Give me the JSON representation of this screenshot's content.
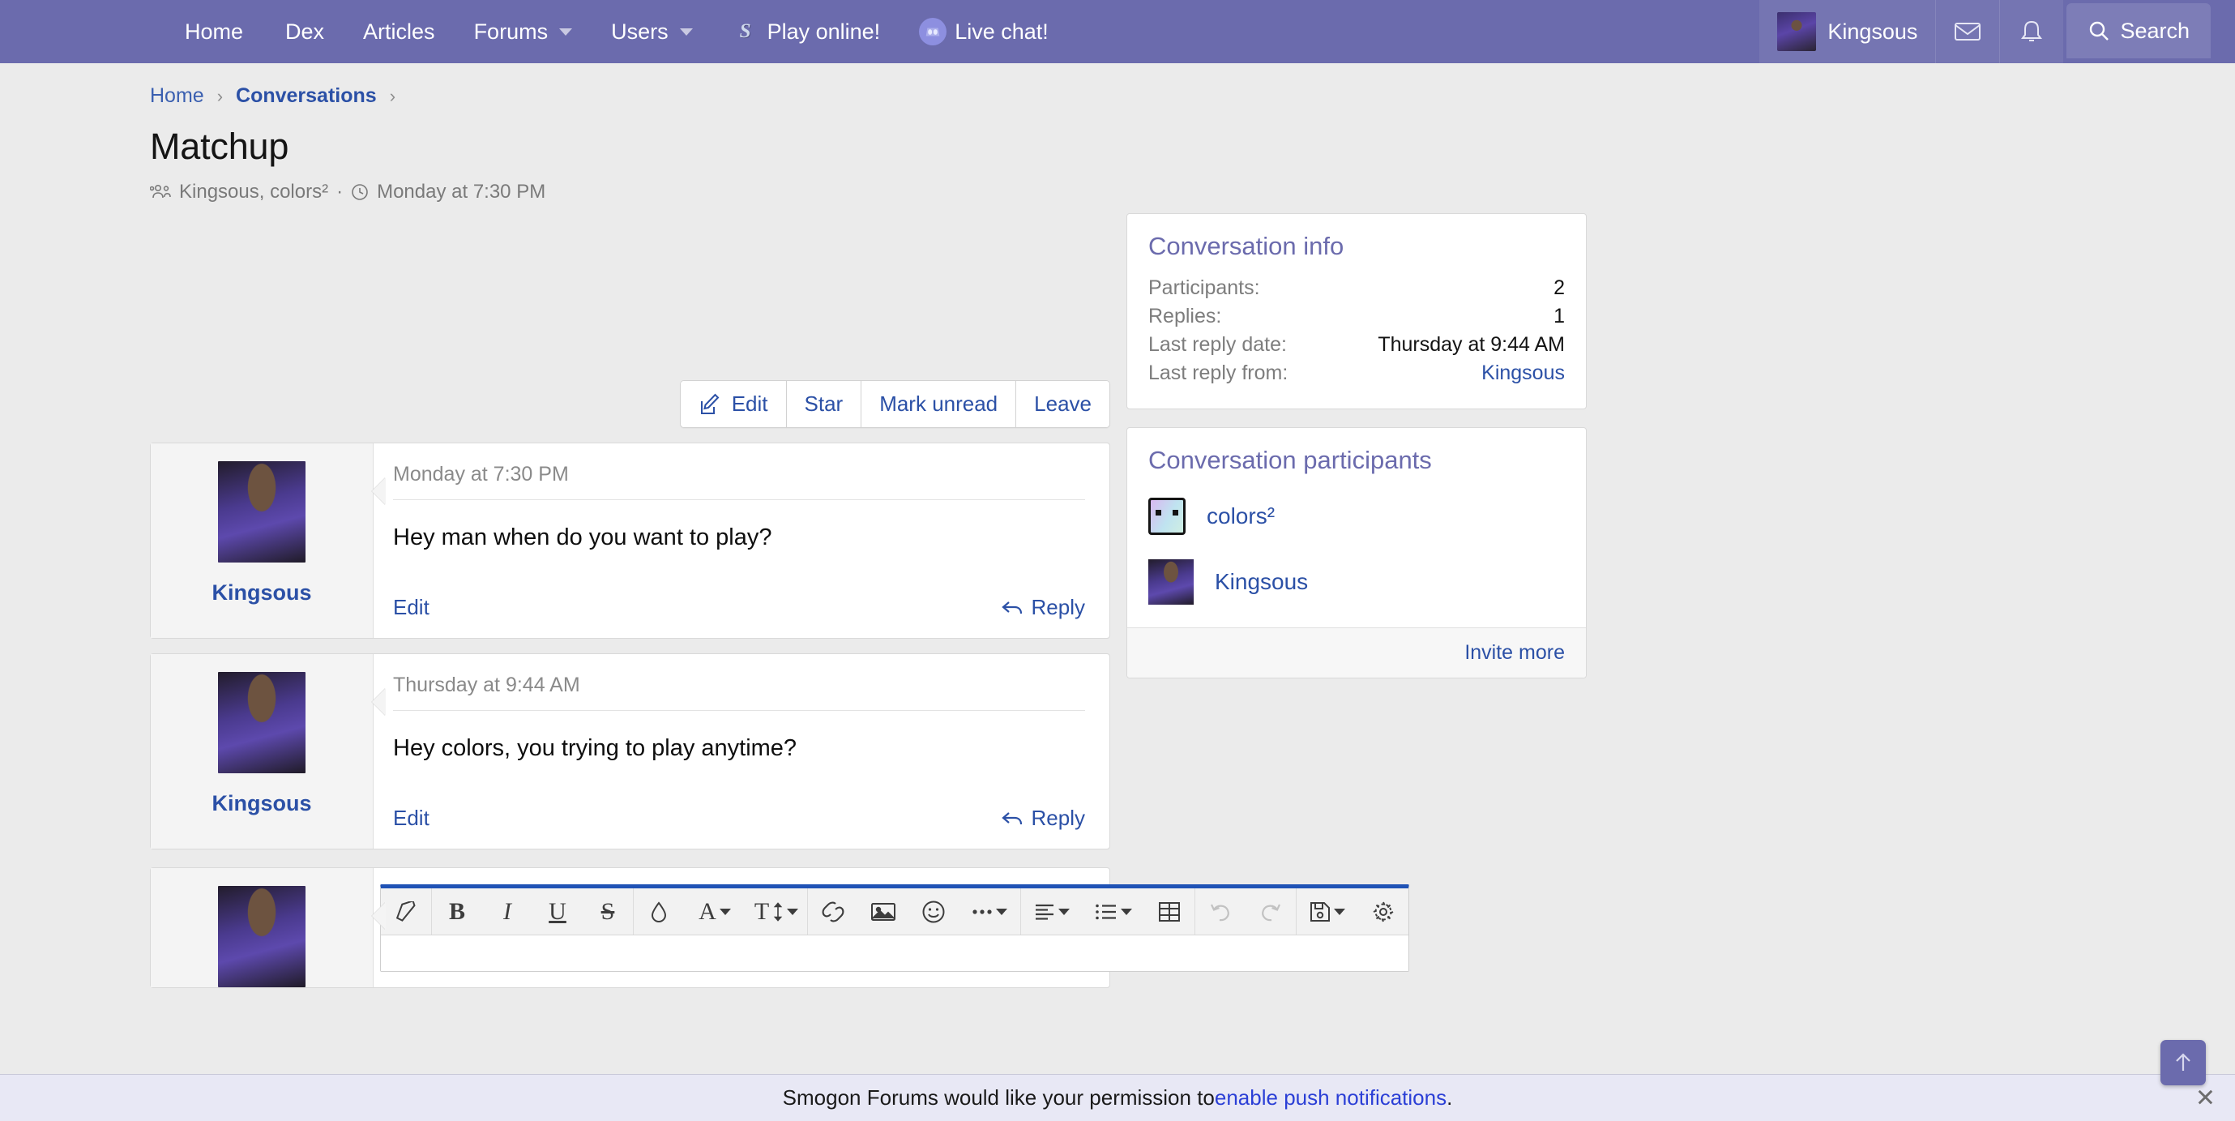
{
  "navbar": {
    "items": [
      {
        "label": "Home",
        "icon": null,
        "caret": false
      },
      {
        "label": "Dex",
        "icon": null,
        "caret": false
      },
      {
        "label": "Articles",
        "icon": null,
        "caret": false
      },
      {
        "label": "Forums",
        "icon": null,
        "caret": true
      },
      {
        "label": "Users",
        "icon": null,
        "caret": true
      },
      {
        "label": "Play online!",
        "icon": "smogon-s-icon",
        "caret": false
      },
      {
        "label": "Live chat!",
        "icon": "discord-icon",
        "caret": false
      }
    ],
    "username": "Kingsous",
    "avatar_icon": "user-avatar",
    "inbox_icon": "envelope-icon",
    "alerts_icon": "bell-icon",
    "search_label": "Search",
    "search_icon": "search-icon",
    "accent_color": "#6b6bad"
  },
  "breadcrumb": {
    "items": [
      {
        "label": "Home",
        "bold": false
      },
      {
        "label": "Conversations",
        "bold": true
      }
    ],
    "separator": "›"
  },
  "header": {
    "title": "Matchup",
    "participants_icon": "users-icon",
    "participants": "Kingsous, colors²",
    "dot": "·",
    "clock_icon": "clock-icon",
    "date": "Monday at 7:30 PM"
  },
  "actions": {
    "edit": "Edit",
    "edit_icon": "pencil-square-icon",
    "star": "Star",
    "mark_unread": "Mark unread",
    "leave": "Leave"
  },
  "messages": [
    {
      "author": "Kingsous",
      "avatar_icon": "user-avatar",
      "date": "Monday at 7:30 PM",
      "text": "Hey man when do you want to play?",
      "edit_label": "Edit",
      "reply_label": "Reply",
      "reply_icon": "reply-arrow-icon"
    },
    {
      "author": "Kingsous",
      "avatar_icon": "user-avatar",
      "date": "Thursday at 9:44 AM",
      "text": "Hey colors, you trying to play anytime?",
      "edit_label": "Edit",
      "reply_label": "Reply",
      "reply_icon": "reply-arrow-icon"
    }
  ],
  "editor": {
    "avatar_icon": "user-avatar",
    "accent_color": "#1f52b5",
    "toolbar_groups": [
      [
        {
          "name": "remove-formatting-icon",
          "glyph": "eraser",
          "caret": false
        }
      ],
      [
        {
          "name": "bold-icon",
          "glyph": "B",
          "caret": false
        },
        {
          "name": "italic-icon",
          "glyph": "I",
          "caret": false
        },
        {
          "name": "underline-icon",
          "glyph": "U",
          "caret": false
        },
        {
          "name": "strikethrough-icon",
          "glyph": "S",
          "caret": false
        }
      ],
      [
        {
          "name": "text-color-icon",
          "glyph": "droplet",
          "caret": false
        },
        {
          "name": "font-family-icon",
          "glyph": "A",
          "caret": true
        },
        {
          "name": "font-size-icon",
          "glyph": "T",
          "caret": true
        }
      ],
      [
        {
          "name": "insert-link-icon",
          "glyph": "link",
          "caret": false
        },
        {
          "name": "insert-image-icon",
          "glyph": "image",
          "caret": false
        },
        {
          "name": "insert-smilie-icon",
          "glyph": "smiley",
          "caret": false
        },
        {
          "name": "more-options-icon",
          "glyph": "ellipsis",
          "caret": true
        }
      ],
      [
        {
          "name": "text-align-icon",
          "glyph": "align",
          "caret": true
        },
        {
          "name": "list-icon",
          "glyph": "list",
          "caret": true
        },
        {
          "name": "insert-table-icon",
          "glyph": "table",
          "caret": false
        }
      ],
      [
        {
          "name": "undo-icon",
          "glyph": "undo",
          "caret": false,
          "disabled": true
        },
        {
          "name": "redo-icon",
          "glyph": "redo",
          "caret": false,
          "disabled": true
        }
      ],
      [
        {
          "name": "drafts-icon",
          "glyph": "save",
          "caret": true
        },
        {
          "name": "editor-settings-icon",
          "glyph": "gear",
          "caret": false
        }
      ]
    ]
  },
  "sidebar": {
    "info_card": {
      "title": "Conversation info",
      "rows": [
        {
          "label": "Participants:",
          "value": "2",
          "link": false
        },
        {
          "label": "Replies:",
          "value": "1",
          "link": false
        },
        {
          "label": "Last reply date:",
          "value": "Thursday at 9:44 AM",
          "link": false
        },
        {
          "label": "Last reply from:",
          "value": "Kingsous",
          "link": true
        }
      ]
    },
    "participants_card": {
      "title": "Conversation participants",
      "participants": [
        {
          "name": "colors²",
          "avatar_icon": "colors-avatar"
        },
        {
          "name": "Kingsous",
          "avatar_icon": "kingsous-avatar"
        }
      ],
      "invite_label": "Invite more"
    }
  },
  "notification": {
    "text_before": "Smogon Forums would like your permission to ",
    "link": "enable push notifications",
    "text_after": ".",
    "close_icon": "close-icon"
  },
  "scroll_top": {
    "icon": "arrow-up-icon"
  }
}
